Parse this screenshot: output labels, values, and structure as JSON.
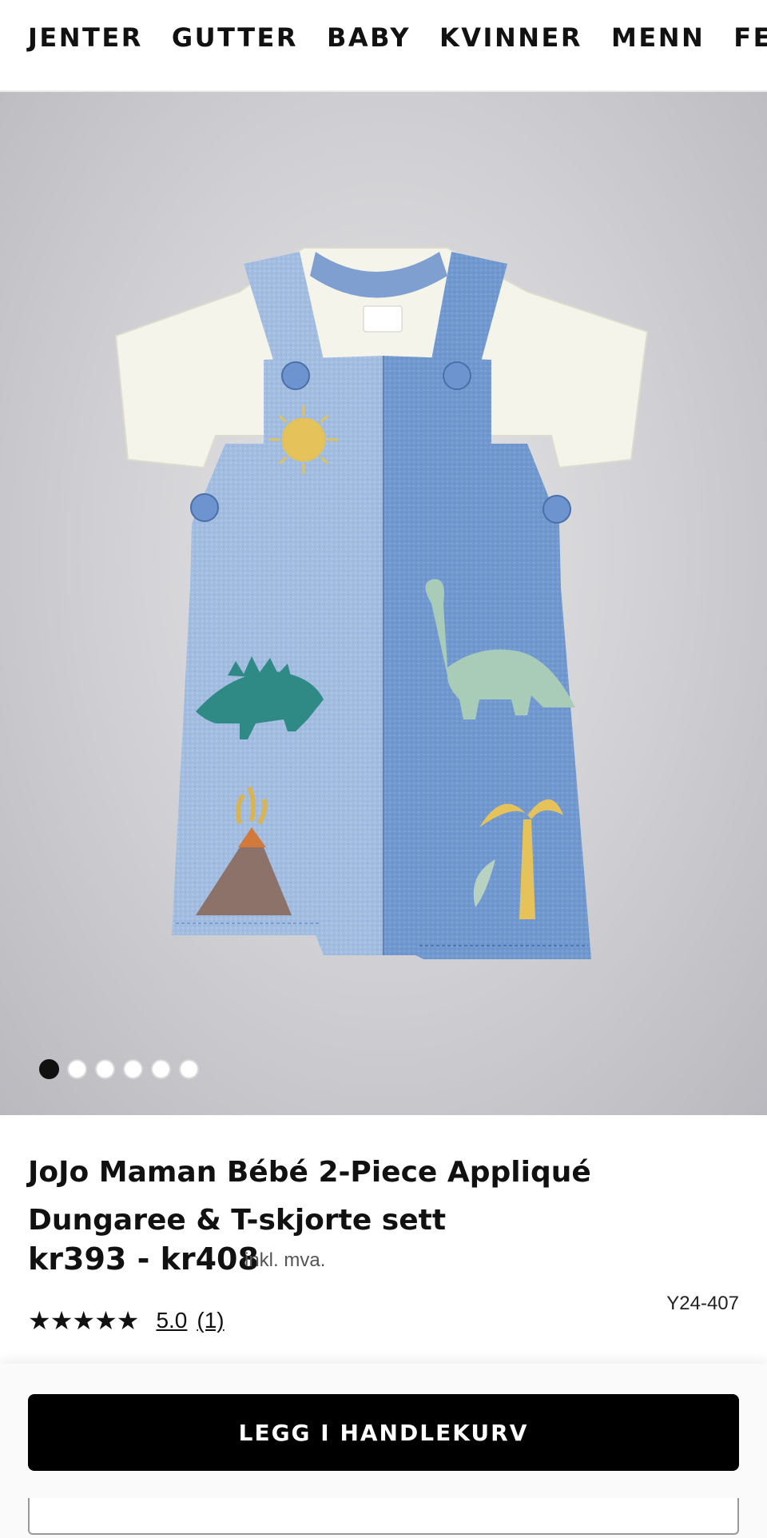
{
  "nav": {
    "items": [
      "JENTER",
      "GUTTER",
      "BABY",
      "KVINNER",
      "MENN",
      "FERIEBU"
    ]
  },
  "gallery": {
    "image_alt": "Blue dungaree with dinosaur appliqués over a white t-shirt",
    "dot_count": 6,
    "active_index": 0
  },
  "product": {
    "title": "JoJo Maman Bébé 2-Piece Appliqué Dungaree & T-skjorte sett",
    "price": "kr393 - kr408",
    "vat_note": "inkl. mva.",
    "stars": "★★★★★",
    "rating_value": 5.0,
    "rating_display": "5.0",
    "review_count": "(1)",
    "sku": "Y24-407"
  },
  "actions": {
    "add_to_cart_label": "LEGG I HANDLEKURV"
  },
  "colors": {
    "cta_background": "#000000",
    "text": "#111111",
    "denim_light": "#9db7dc",
    "denim_dark": "#6f98cf"
  }
}
